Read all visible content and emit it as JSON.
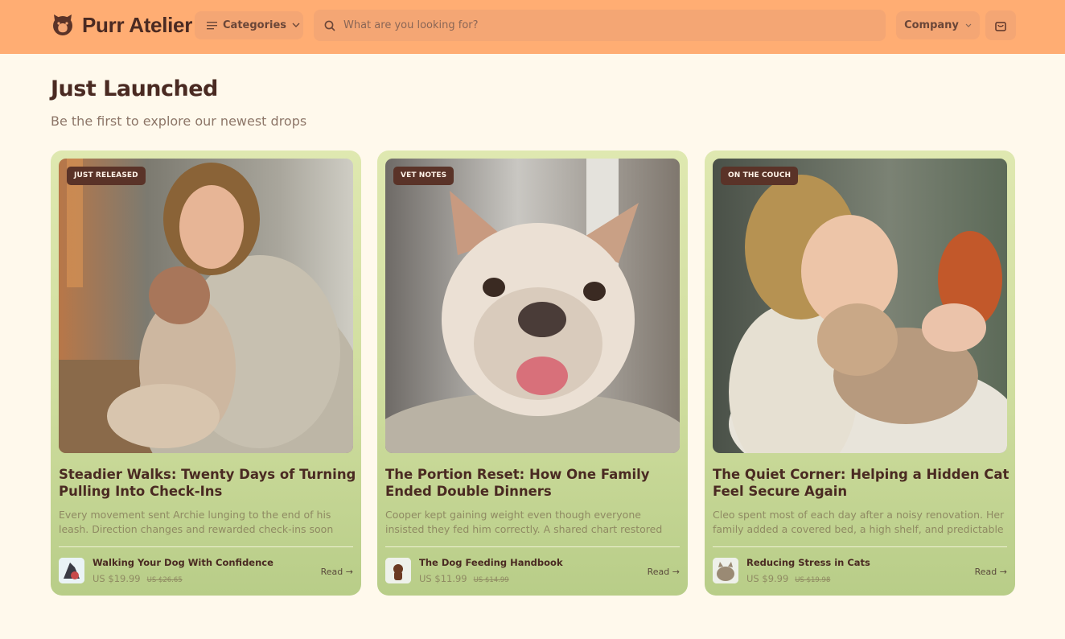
{
  "brand": {
    "name": "Purr Atelier"
  },
  "header": {
    "categories_label": "Categories",
    "search_placeholder": "What are you looking for?",
    "company_label": "Company"
  },
  "section": {
    "title": "Just Launched",
    "subtitle": "Be the first to explore our newest drops"
  },
  "cards": [
    {
      "badge": "JUST RELEASED",
      "title": "Steadier Walks: Twenty Days of Turning Pulling Into Check-Ins",
      "description": "Every movement sent Archie lunging to the end of his leash. Direction changes and rewarded check-ins soon made walks",
      "product": {
        "name": "Walking Your Dog With Confidence",
        "price": "US $19.99",
        "old_price": "US $26.65"
      },
      "read_label": "Read →"
    },
    {
      "badge": "VET NOTES",
      "title": "The Portion Reset: How One Family Ended Double Dinners",
      "description": "Cooper kept gaining weight even though everyone insisted they fed him correctly. A shared chart restored healthy",
      "product": {
        "name": "The Dog Feeding Handbook",
        "price": "US $11.99",
        "old_price": "US $14.99"
      },
      "read_label": "Read →"
    },
    {
      "badge": "ON THE COUCH",
      "title": "The Quiet Corner: Helping a Hidden Cat Feel Secure Again",
      "description": "Cleo spent most of each day after a noisy renovation. Her family added a covered bed, a high shelf, and predictable",
      "product": {
        "name": "Reducing Stress in Cats",
        "price": "US $9.99",
        "old_price": "US $19.98"
      },
      "read_label": "Read →"
    }
  ]
}
